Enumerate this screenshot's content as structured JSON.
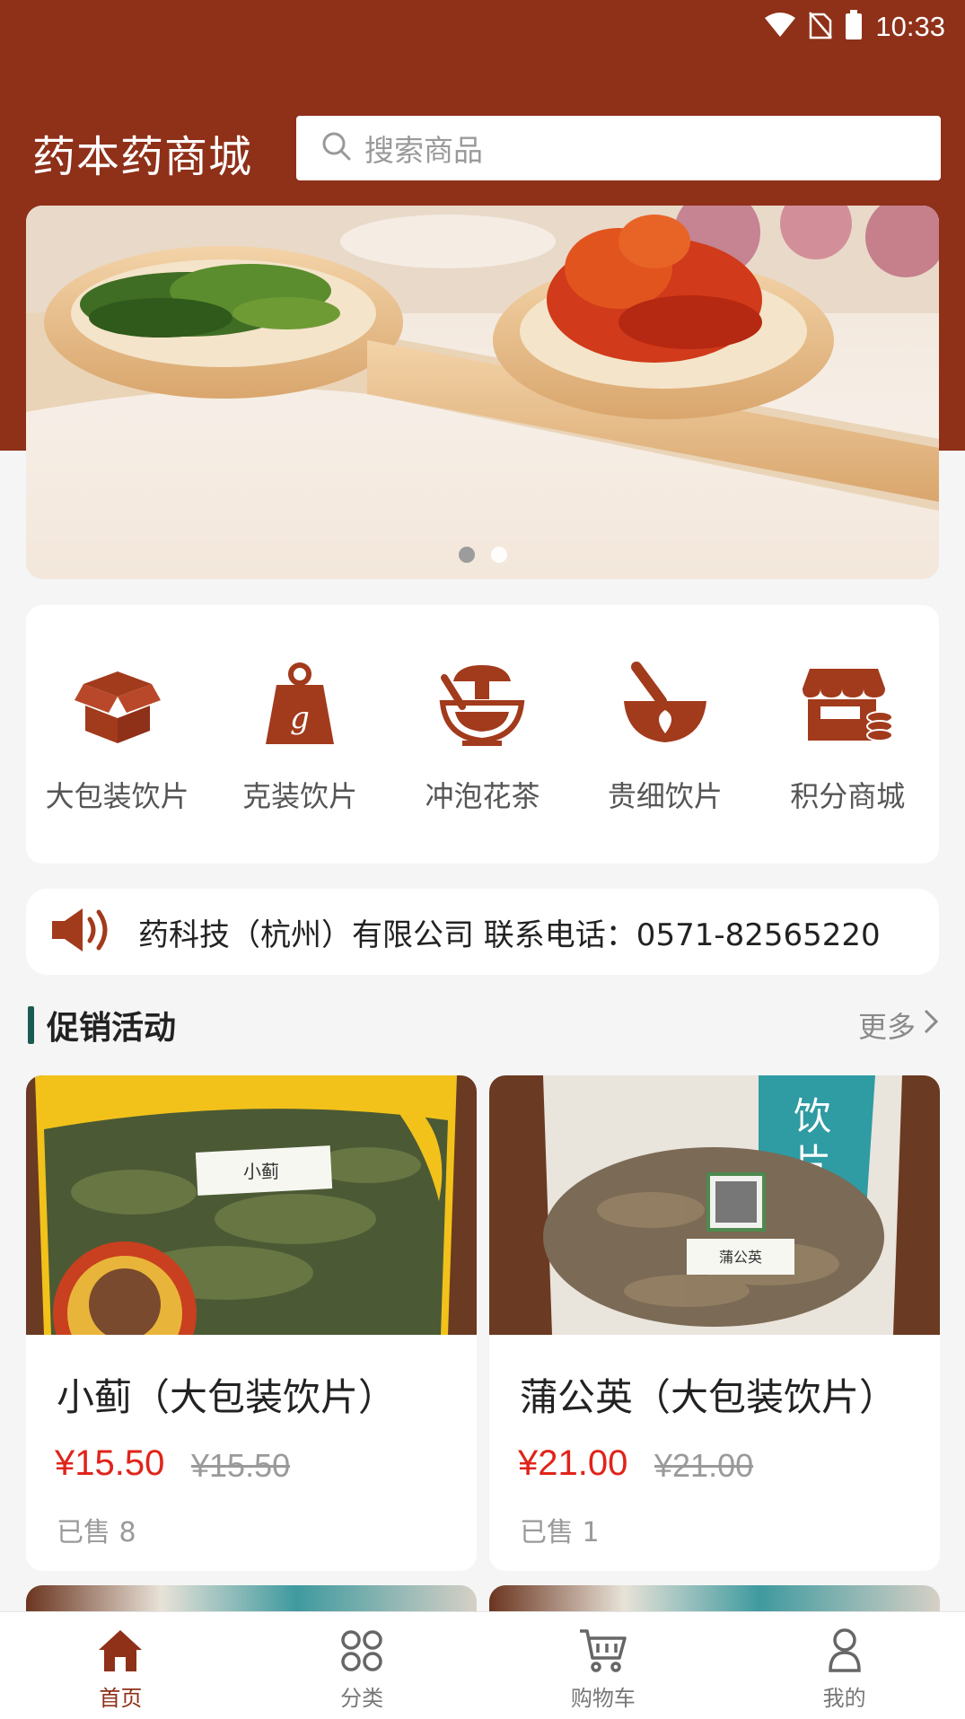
{
  "status_bar": {
    "time": "10:33"
  },
  "header": {
    "title": "药本药商城",
    "search_placeholder": "搜索商品"
  },
  "banner": {
    "slides": 2,
    "active_index": 0
  },
  "categories": [
    {
      "label": "大包装饮片",
      "icon": "open-box-icon"
    },
    {
      "label": "克装饮片",
      "icon": "gram-weight-icon"
    },
    {
      "label": "冲泡花茶",
      "icon": "mortar-mushroom-icon"
    },
    {
      "label": "贵细饮片",
      "icon": "mortar-pestle-icon"
    },
    {
      "label": "积分商城",
      "icon": "store-coins-icon"
    }
  ],
  "notice": {
    "text": "药科技（杭州）有限公司 联系电话：0571-82565220"
  },
  "promotions": {
    "title": "促销活动",
    "more_label": "更多",
    "products": [
      {
        "name": "小蓟（大包装饮片）",
        "price": "¥15.50",
        "original_price": "¥15.50",
        "sold": "已售 8",
        "bag_label": "小蓟"
      },
      {
        "name": "蒲公英（大包装饮片）",
        "price": "¥21.00",
        "original_price": "¥21.00",
        "sold": "已售 1",
        "bag_label": "蒲公英"
      }
    ]
  },
  "tabbar": [
    {
      "label": "首页",
      "active": true
    },
    {
      "label": "分类",
      "active": false
    },
    {
      "label": "购物车",
      "active": false
    },
    {
      "label": "我的",
      "active": false
    }
  ],
  "colors": {
    "brand": "#8f3019",
    "price": "#e0241a",
    "section_accent": "#1b5b52",
    "icon": "#a23a1c"
  }
}
